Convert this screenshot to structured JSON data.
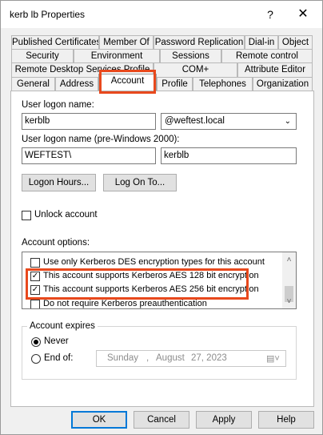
{
  "window": {
    "title": "kerb lb Properties",
    "help_glyph": "?",
    "close_glyph": "✕"
  },
  "tabs": {
    "row1": [
      "Published Certificates",
      "Member Of",
      "Password Replication",
      "Dial-in",
      "Object"
    ],
    "row2": [
      "Security",
      "Environment",
      "Sessions",
      "Remote control"
    ],
    "row3": [
      "Remote Desktop Services Profile",
      "COM+",
      "Attribute Editor"
    ],
    "row4": [
      "General",
      "Address",
      "Account",
      "Profile",
      "Telephones",
      "Organization"
    ],
    "active": "Account"
  },
  "account": {
    "logon_name_label": "User logon name:",
    "logon_name_value": "kerblb",
    "domain_value": "@weftest.local",
    "pre2000_label": "User logon name (pre-Windows 2000):",
    "pre2000_domain": "WEFTEST\\",
    "pre2000_name": "kerblb",
    "logon_hours_button": "Logon Hours...",
    "logon_to_button": "Log On To...",
    "unlock_label": "Unlock account",
    "options_label": "Account options:",
    "options": [
      {
        "label": "Use only Kerberos DES encryption types for this account",
        "checked": false
      },
      {
        "label": "This account supports Kerberos AES 128 bit encryption",
        "checked": true
      },
      {
        "label": "This account supports Kerberos AES 256 bit encryption",
        "checked": true
      },
      {
        "label": "Do not require Kerberos preauthentication",
        "checked": false
      }
    ],
    "expires_title": "Account expires",
    "never_label": "Never",
    "end_of_label": "End of:",
    "expires_selected": "Never",
    "date": {
      "weekday": "Sunday",
      "sep1": ",",
      "month": "August",
      "day_year": "27, 2023"
    }
  },
  "buttons": {
    "ok": "OK",
    "cancel": "Cancel",
    "apply": "Apply",
    "help": "Help"
  },
  "highlight_color": "#e8491d",
  "accent_color": "#0078d7"
}
